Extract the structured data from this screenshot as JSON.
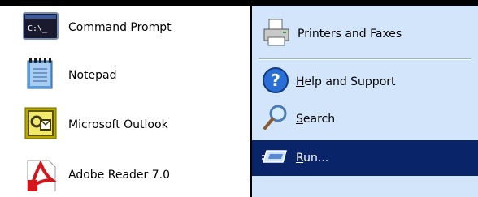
{
  "left_menu": {
    "items": [
      {
        "label": "Command Prompt",
        "icon": "command-prompt-icon",
        "icon_text": "C:\\_"
      },
      {
        "label": "Notepad",
        "icon": "notepad-icon"
      },
      {
        "label": "Microsoft Outlook",
        "icon": "outlook-icon"
      },
      {
        "label": "Adobe Reader 7.0",
        "icon": "adobe-reader-icon"
      }
    ]
  },
  "right_menu": {
    "items": [
      {
        "label": "Printers and Faxes",
        "icon": "printer-icon"
      },
      {
        "mnemonic": "H",
        "rest": "elp and Support",
        "icon": "help-icon"
      },
      {
        "mnemonic": "S",
        "rest": "earch",
        "icon": "search-icon"
      },
      {
        "mnemonic": "R",
        "rest": "un...",
        "icon": "run-icon",
        "highlighted": true
      }
    ]
  },
  "colors": {
    "right_pane_bg": "#d3e5fa",
    "highlight_bg": "#0a246a",
    "highlight_text": "#ffffff"
  }
}
